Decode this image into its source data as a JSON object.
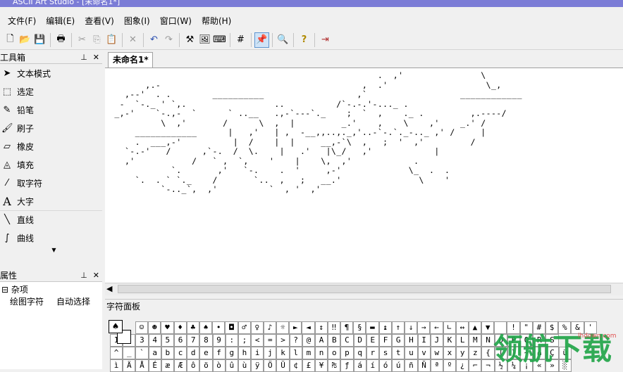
{
  "window": {
    "title": "ASCII Art Studio - [未命名1*]"
  },
  "menu": [
    "文件(F)",
    "编辑(E)",
    "查看(V)",
    "图象(I)",
    "窗口(W)",
    "帮助(H)"
  ],
  "toolbar": {
    "buttons": [
      {
        "name": "new-icon",
        "glyph": "🗋"
      },
      {
        "name": "open-icon",
        "glyph": "📂"
      },
      {
        "name": "save-icon",
        "glyph": "💾"
      },
      {
        "name": "print-icon",
        "glyph": "🖶"
      },
      {
        "name": "cut-icon",
        "glyph": "✂"
      },
      {
        "name": "copy-icon",
        "glyph": "⎘"
      },
      {
        "name": "paste-icon",
        "glyph": "📋"
      },
      {
        "name": "delete-icon",
        "glyph": "✕"
      },
      {
        "name": "undo-icon",
        "glyph": "↶"
      },
      {
        "name": "redo-icon",
        "glyph": "↷"
      },
      {
        "name": "tools-icon",
        "glyph": "⚒"
      },
      {
        "name": "image-icon",
        "glyph": "🖼"
      },
      {
        "name": "keyboard-icon",
        "glyph": "⌨"
      },
      {
        "name": "grid-icon",
        "glyph": "#"
      },
      {
        "name": "pin-icon",
        "glyph": "📌"
      },
      {
        "name": "zoom-icon",
        "glyph": "🔍"
      },
      {
        "name": "help-icon",
        "glyph": "?"
      },
      {
        "name": "exit-icon",
        "glyph": "⇥"
      }
    ]
  },
  "toolbox": {
    "title": "工具箱",
    "tools": [
      {
        "name": "tool-text-mode",
        "icon": "arrow-icon",
        "glyph": "➤",
        "label": "文本模式"
      },
      {
        "name": "tool-select",
        "icon": "marquee-icon",
        "glyph": "⬚",
        "label": "选定"
      },
      {
        "name": "tool-pencil",
        "icon": "pencil-icon",
        "glyph": "✎",
        "label": "铅笔"
      },
      {
        "name": "tool-brush",
        "icon": "brush-icon",
        "glyph": "🖌",
        "label": "刷子"
      },
      {
        "name": "tool-eraser",
        "icon": "eraser-icon",
        "glyph": "▱",
        "label": "橡皮"
      },
      {
        "name": "tool-fill",
        "icon": "bucket-icon",
        "glyph": "◬",
        "label": "填充"
      },
      {
        "name": "tool-pick",
        "icon": "eyedropper-icon",
        "glyph": "⁄",
        "label": "取字符"
      },
      {
        "name": "tool-big-text",
        "icon": "letter-a-icon",
        "glyph": "A",
        "label": "大字"
      },
      {
        "name": "tool-line",
        "icon": "line-icon",
        "glyph": "╲",
        "label": "直线"
      },
      {
        "name": "tool-curve",
        "icon": "curve-icon",
        "glyph": "∫",
        "label": "曲线"
      }
    ]
  },
  "properties": {
    "title": "属性",
    "group": "杂项",
    "row_key": "绘图字符",
    "row_value": "自动选择"
  },
  "document": {
    "tab": "未命名1*",
    "ascii": "                                                    .  ,'               \\\n       ,.-                                       ,  .'                   \\_,\n   ,--'  . .        __________                  ,`                  ____________\n  -  `-._ ' `,.                 ..          /`-.-.'-..._ .       \n _,-'    `-.,-  `      ` ..__   .,-`---`._    ;  `  ,    ._ .         ,.----/\n          \\  ,'       /      \\  ,  |         _.'    ,    \\    ,'    _.' /\n     ____________      |   ,'   | ,  -__,,..,._,'..-`-.`._-.._ ,' /     |\n     .  ___,-'          |  /    |  |     __,-`\\  ,   ;  '  ,'         /\n   `-.-'   /      ,`-.  /  \\.    |   .'   |\\_/   ,'            |\n   ,'           /   ` ,  `,    '    |    \\,  ,'            .\n            `.       ,'   `-.    .  '     ,-'             \\_  .  .\n     `.  . ` `._    /       `..  ,   ;   __.'               \\    '\n          `-.._`,  ,'          `  , '  ,'               "
  },
  "char_panel": {
    "title": "字符面板",
    "selected": "♠",
    "rows": [
      [
        "☺",
        "☻",
        "♥",
        "♦",
        "♣",
        "♠",
        "•",
        "◘",
        "♂",
        "♀",
        "♪",
        "☼",
        "►",
        "◄",
        "↕",
        "‼",
        "¶",
        "§",
        "▬",
        "↨",
        "↑",
        "↓",
        "→",
        "←",
        "∟",
        "↔",
        "▲",
        "▼",
        " ",
        "!",
        "\"",
        "#",
        "$",
        "%",
        "&",
        "'"
      ],
      [
        "1",
        "2",
        "3",
        "4",
        "5",
        "6",
        "7",
        "8",
        "9",
        ":",
        ";",
        "<",
        "=",
        ">",
        "?",
        "@",
        "A",
        "B",
        "C",
        "D",
        "E",
        "F",
        "G",
        "H",
        "I",
        "J",
        "K",
        "L",
        "M",
        "N",
        "O",
        "P",
        "Q",
        "R",
        "S"
      ],
      [
        "^",
        "_",
        "`",
        "a",
        "b",
        "c",
        "d",
        "e",
        "f",
        "g",
        "h",
        "i",
        "j",
        "k",
        "l",
        "m",
        "n",
        "o",
        "p",
        "q",
        "r",
        "s",
        "t",
        "u",
        "v",
        "w",
        "x",
        "y",
        "z",
        "{",
        "|",
        "}",
        "~",
        "⌂",
        "Ç",
        "ü"
      ],
      [
        "ì",
        "Ä",
        "Å",
        "É",
        "æ",
        "Æ",
        "ô",
        "ö",
        "ò",
        "û",
        "ù",
        "ÿ",
        "Ö",
        "Ü",
        "¢",
        "£",
        "¥",
        "₧",
        "ƒ",
        "á",
        "í",
        "ó",
        "ú",
        "ñ",
        "Ñ",
        "ª",
        "º",
        "¿",
        "⌐",
        "¬",
        "½",
        "¼",
        "¡",
        "«",
        "»",
        "░"
      ]
    ]
  },
  "watermark": {
    "text": "领航下载",
    "url": "lhdown.com"
  }
}
